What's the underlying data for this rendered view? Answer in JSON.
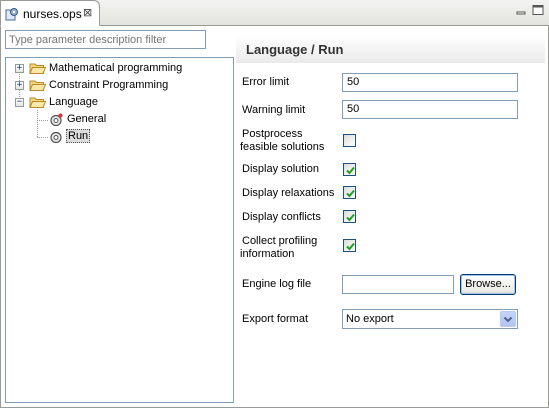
{
  "tab": {
    "title": "nurses.ops",
    "close": "⊠"
  },
  "filter": {
    "placeholder": "Type parameter description filter"
  },
  "tree": {
    "items": [
      {
        "label": "Mathematical programming",
        "expander": "+"
      },
      {
        "label": "Constraint Programming",
        "expander": "+"
      },
      {
        "label": "Language",
        "expander": "−"
      },
      {
        "label": "General"
      },
      {
        "label": "Run"
      }
    ]
  },
  "panel": {
    "title": "Language / Run",
    "error_limit_label": "Error limit",
    "error_limit_value": "50",
    "warning_limit_label": "Warning limit",
    "warning_limit_value": "50",
    "postprocess_label_1": "Postprocess",
    "postprocess_label_2": "feasible solutions",
    "postprocess_checked": false,
    "display_solution_label": "Display solution",
    "display_solution_checked": true,
    "display_relaxations_label": "Display relaxations",
    "display_relaxations_checked": true,
    "display_conflicts_label": "Display conflicts",
    "display_conflicts_checked": true,
    "collect_profiling_label_1": "Collect profiling",
    "collect_profiling_label_2": "information",
    "collect_profiling_checked": true,
    "engine_log_label": "Engine log file",
    "engine_log_value": "",
    "browse_label": "Browse...",
    "export_format_label": "Export format",
    "export_format_value": "No export"
  },
  "colors": {
    "check": "#21a121",
    "accent_border": "#7f9db9"
  }
}
